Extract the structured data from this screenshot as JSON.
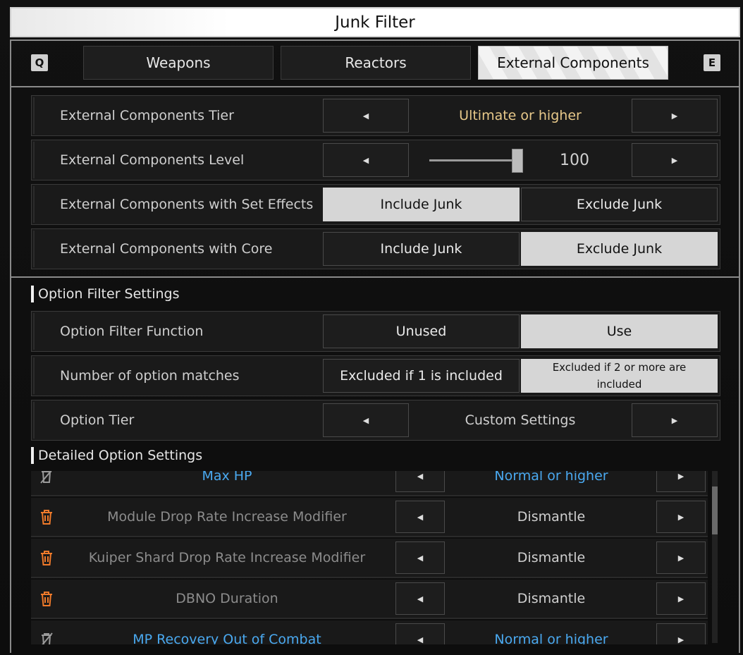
{
  "window": {
    "title": "Junk Filter"
  },
  "tabs": {
    "prev_key": "Q",
    "next_key": "E",
    "items": [
      {
        "label": "Weapons",
        "active": false
      },
      {
        "label": "Reactors",
        "active": false
      },
      {
        "label": "External Components",
        "active": true
      }
    ]
  },
  "settings": {
    "tier": {
      "label": "External Components Tier",
      "value": "Ultimate or higher"
    },
    "level": {
      "label": "External Components Level",
      "value": "100",
      "slider_fraction": 1.0
    },
    "set_effects": {
      "label": "External Components with Set Effects",
      "option_a": "Include Junk",
      "option_b": "Exclude Junk",
      "selected": "option_a"
    },
    "core": {
      "label": "External Components with Core",
      "option_a": "Include Junk",
      "option_b": "Exclude Junk",
      "selected": "option_b"
    }
  },
  "option_filter": {
    "section_title": "Option Filter Settings",
    "function": {
      "label": "Option Filter Function",
      "option_a": "Unused",
      "option_b": "Use",
      "selected": "option_b"
    },
    "matches": {
      "label": "Number of option matches",
      "option_a": "Excluded if 1 is included",
      "option_b": "Excluded if 2 or more are included",
      "selected": "option_b"
    },
    "tier": {
      "label": "Option Tier",
      "value": "Custom Settings"
    }
  },
  "detailed": {
    "section_title": "Detailed Option Settings",
    "items": [
      {
        "name": "Max HP",
        "value": "Normal or higher",
        "icon": "trash-disabled-icon",
        "highlight": true
      },
      {
        "name": "Module Drop Rate Increase Modifier",
        "value": "Dismantle",
        "icon": "trash-icon",
        "highlight": false
      },
      {
        "name": "Kuiper Shard Drop Rate Increase Modifier",
        "value": "Dismantle",
        "icon": "trash-icon",
        "highlight": false
      },
      {
        "name": "DBNO Duration",
        "value": "Dismantle",
        "icon": "trash-icon",
        "highlight": false
      },
      {
        "name": "MP Recovery Out of Combat",
        "value": "Normal or higher",
        "icon": "trash-disabled-icon",
        "highlight": true
      }
    ]
  },
  "colors": {
    "gold": "#e8c98a",
    "blue": "#4aa9f0",
    "trash_orange": "#f07a2a",
    "selected_bg": "#d6d6d6"
  }
}
